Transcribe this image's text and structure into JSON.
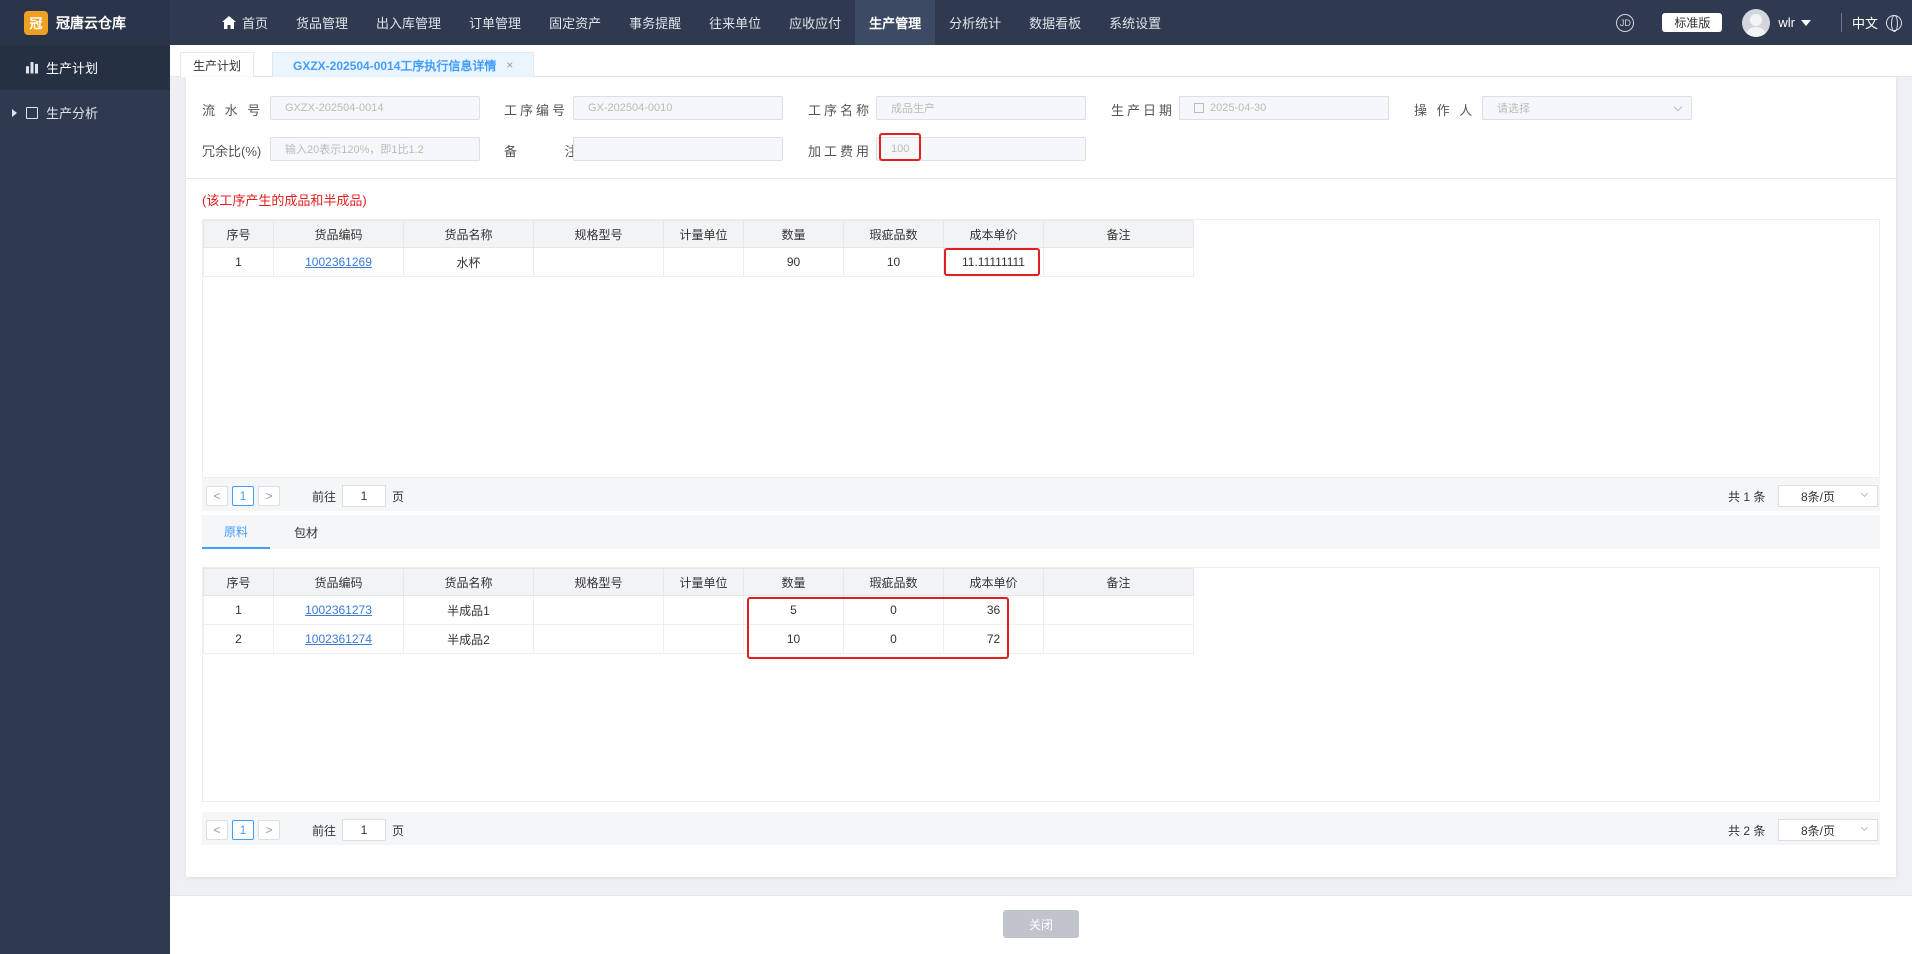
{
  "app": {
    "name": "冠唐云仓库",
    "logo_char": "冠"
  },
  "nav": [
    {
      "label": "首页"
    },
    {
      "label": "货品管理"
    },
    {
      "label": "出入库管理"
    },
    {
      "label": "订单管理"
    },
    {
      "label": "固定资产"
    },
    {
      "label": "事务提醒"
    },
    {
      "label": "往来单位"
    },
    {
      "label": "应收应付"
    },
    {
      "label": "生产管理"
    },
    {
      "label": "分析统计"
    },
    {
      "label": "数据看板"
    },
    {
      "label": "系统设置"
    }
  ],
  "topright": {
    "edition": "标准版",
    "user": "wlr",
    "lang": "中文",
    "circle_icon_text": "JD"
  },
  "sidebar": {
    "items": [
      {
        "label": "生产计划"
      },
      {
        "label": "生产分析"
      }
    ]
  },
  "tabs": {
    "t1": "生产计划",
    "t2": "GXZX-202504-0014工序执行信息详情",
    "close": "×"
  },
  "form": {
    "serial": {
      "label": "流 水 号",
      "value": "GXZX-202504-0014"
    },
    "process_no": {
      "label": "工序编号",
      "value": "GX-202504-0010"
    },
    "process_name": {
      "label": "工序名称",
      "value": "成品生产"
    },
    "date": {
      "label": "生产日期",
      "value": "2025-04-30"
    },
    "operator": {
      "label": "操 作 人",
      "placeholder": "请选择"
    },
    "redundancy": {
      "label": "冗余比(%)",
      "placeholder": "输入20表示120%，即1比1.2"
    },
    "remark": {
      "label": "备 注",
      "value": ""
    },
    "fee": {
      "label": "加工费用",
      "value": "100"
    }
  },
  "section_title": "(该工序产生的成品和半成品)",
  "columns": [
    "序号",
    "货品编码",
    "货品名称",
    "规格型号",
    "计量单位",
    "数量",
    "瑕疵品数",
    "成本单价",
    "备注"
  ],
  "products": {
    "rows": [
      {
        "no": "1",
        "code": "1002361269",
        "name": "水杯",
        "spec": "",
        "unit": "",
        "qty": "90",
        "defect": "10",
        "price": "11.11111111",
        "note": ""
      }
    ],
    "pager": {
      "prev": "<",
      "page": "1",
      "next": ">",
      "goto": "前往",
      "goto_value": "1",
      "page_suffix": "页",
      "total": "共 1 条",
      "size": "8条/页"
    }
  },
  "subtabs": {
    "active": "原料",
    "inactive": "包材"
  },
  "materials": {
    "rows": [
      {
        "no": "1",
        "code": "1002361273",
        "name": "半成品1",
        "spec": "",
        "unit": "",
        "qty": "5",
        "defect": "0",
        "price": "36",
        "note": ""
      },
      {
        "no": "2",
        "code": "1002361274",
        "name": "半成品2",
        "spec": "",
        "unit": "",
        "qty": "10",
        "defect": "0",
        "price": "72",
        "note": ""
      }
    ],
    "pager": {
      "prev": "<",
      "page": "1",
      "next": ">",
      "goto": "前往",
      "goto_value": "1",
      "page_suffix": "页",
      "total": "共 2 条",
      "size": "8条/页"
    }
  },
  "footer": {
    "close": "关闭"
  }
}
